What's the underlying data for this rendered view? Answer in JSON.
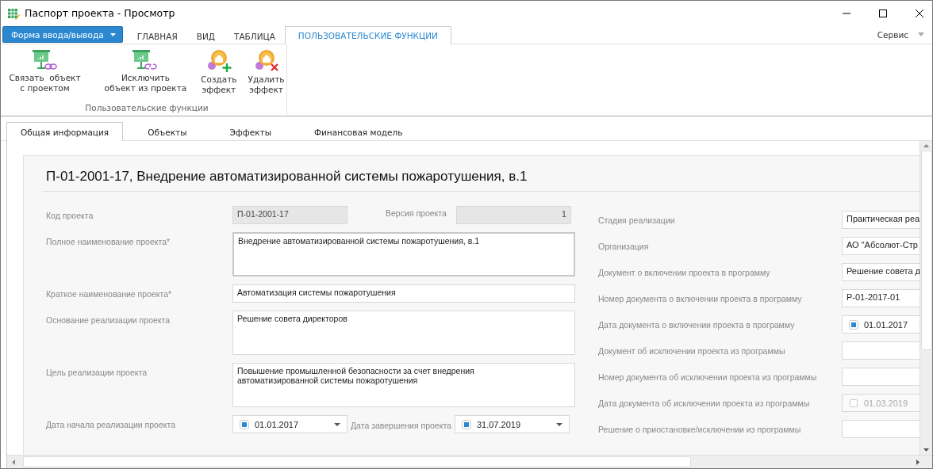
{
  "window": {
    "title": "Паспорт проекта - Просмотр"
  },
  "ribbon": {
    "app_menu": "Форма ввода/вывода",
    "service": "Сервис",
    "tabs": [
      {
        "label": "ГЛАВНАЯ",
        "selected": false
      },
      {
        "label": "ВИД",
        "selected": false
      },
      {
        "label": "ТАБЛИЦА",
        "selected": false
      },
      {
        "label": "ПОЛЬЗОВАТЕЛЬСКИЕ ФУНКЦИИ",
        "selected": true
      }
    ],
    "buttons": [
      {
        "label": "Связать  объект\nс проектом",
        "kind": "link"
      },
      {
        "label": "Исключить\nобъект из проекта",
        "kind": "unlink"
      },
      {
        "label": "Создать\nэффект",
        "kind": "add"
      },
      {
        "label": "Удалить\nэффект",
        "kind": "delete"
      }
    ],
    "group_label": "Пользовательские функции"
  },
  "doc_tabs": [
    {
      "label": "Общая информация",
      "selected": true
    },
    {
      "label": "Объекты",
      "selected": false
    },
    {
      "label": "Эффекты",
      "selected": false
    },
    {
      "label": "Финансовая модель",
      "selected": false
    }
  ],
  "form": {
    "title": "П-01-2001-17, Внедрение автоматизированной системы пожаротушения, в.1",
    "left": [
      {
        "kind": "code",
        "label": "Код проекта",
        "value": "П-01-2001-17",
        "version_label": "Версия проекта",
        "version": "1"
      },
      {
        "kind": "area",
        "label": "Полное наименование проекта*",
        "value": "Внедрение автоматизированной системы пожаротушения, в.1",
        "focused": true
      },
      {
        "kind": "text",
        "label": "Краткое наименование проекта*",
        "value": "Автоматизация системы пожаротушения"
      },
      {
        "kind": "area",
        "label": "Основание реализации проекта",
        "value": "Решение совета директоров",
        "focused": false
      },
      {
        "kind": "area",
        "label": "Цель реализации проекта",
        "value": "Повышение промышленной безопасности за счет внедрения\nавтоматизированной системы пожаротушения",
        "focused": false
      },
      {
        "kind": "dates",
        "label": "Дата начала реализации проекта",
        "start": {
          "value": "01.01.2017",
          "checked": true
        },
        "end_label": "Дата завершения проекта",
        "end": {
          "value": "31.07.2019",
          "checked": true
        }
      }
    ],
    "right": [
      {
        "kind": "text",
        "label": "Стадия реализации",
        "value": "Практическая реа"
      },
      {
        "kind": "text",
        "label": "Организация",
        "value": "АО \"Абсолют-Стр"
      },
      {
        "kind": "text",
        "label": "Документ о включении проекта в программу",
        "value": "Решение совета д"
      },
      {
        "kind": "text",
        "label": "Номер документа о включении проекта в программу",
        "value": "Р-01-2017-01"
      },
      {
        "kind": "date",
        "label": "Дата документа о включении проекта в программу",
        "value": "01.01.2017",
        "checked": true
      },
      {
        "kind": "text",
        "label": "Документ об исключении проекта из программы"
      },
      {
        "kind": "text",
        "label": "Номер документа об исключении проекта из программы"
      },
      {
        "kind": "date",
        "label": "Дата документа об исключении проекта из программы",
        "value": "01.03.2019",
        "checked": false
      },
      {
        "kind": "text",
        "label": "Решение о приостановке/исключении из программы"
      }
    ]
  }
}
